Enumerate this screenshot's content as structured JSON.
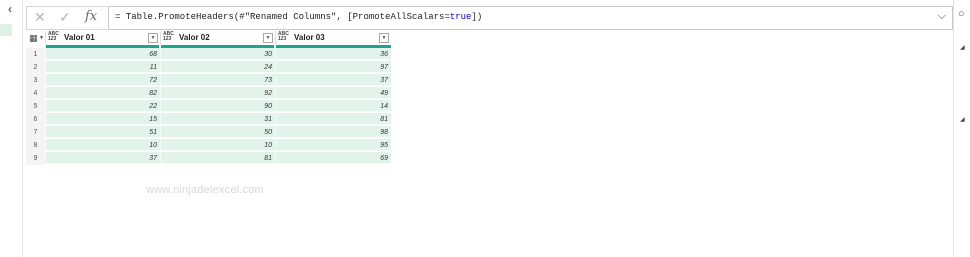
{
  "formula": {
    "prefix": "= Table.PromoteHeaders(#\"Renamed Columns\", [PromoteAllScalars=",
    "keyword": "true",
    "suffix": "])",
    "cancel_icon": "close-icon",
    "commit_icon": "check-icon",
    "fx_label": "fx"
  },
  "table": {
    "type_label_top": "ABC",
    "type_label_bottom": "123",
    "columns": [
      {
        "name": "Valor 01"
      },
      {
        "name": "Valor 02"
      },
      {
        "name": "Valor 03"
      }
    ],
    "rows": [
      {
        "n": "1",
        "a": "68",
        "b": "30",
        "c": "36"
      },
      {
        "n": "2",
        "a": "11",
        "b": "24",
        "c": "97"
      },
      {
        "n": "3",
        "a": "72",
        "b": "73",
        "c": "37"
      },
      {
        "n": "4",
        "a": "82",
        "b": "92",
        "c": "49"
      },
      {
        "n": "5",
        "a": "22",
        "b": "90",
        "c": "14"
      },
      {
        "n": "6",
        "a": "15",
        "b": "31",
        "c": "81"
      },
      {
        "n": "7",
        "a": "51",
        "b": "50",
        "c": "98"
      },
      {
        "n": "8",
        "a": "10",
        "b": "10",
        "c": "95"
      },
      {
        "n": "9",
        "a": "37",
        "b": "81",
        "c": "69"
      }
    ]
  },
  "watermark": "www.ninjadelexcel.com",
  "colors": {
    "quality_bar": "#1aa68c",
    "cell_bg": "#e2f3ea",
    "keyword": "#0000cc"
  }
}
